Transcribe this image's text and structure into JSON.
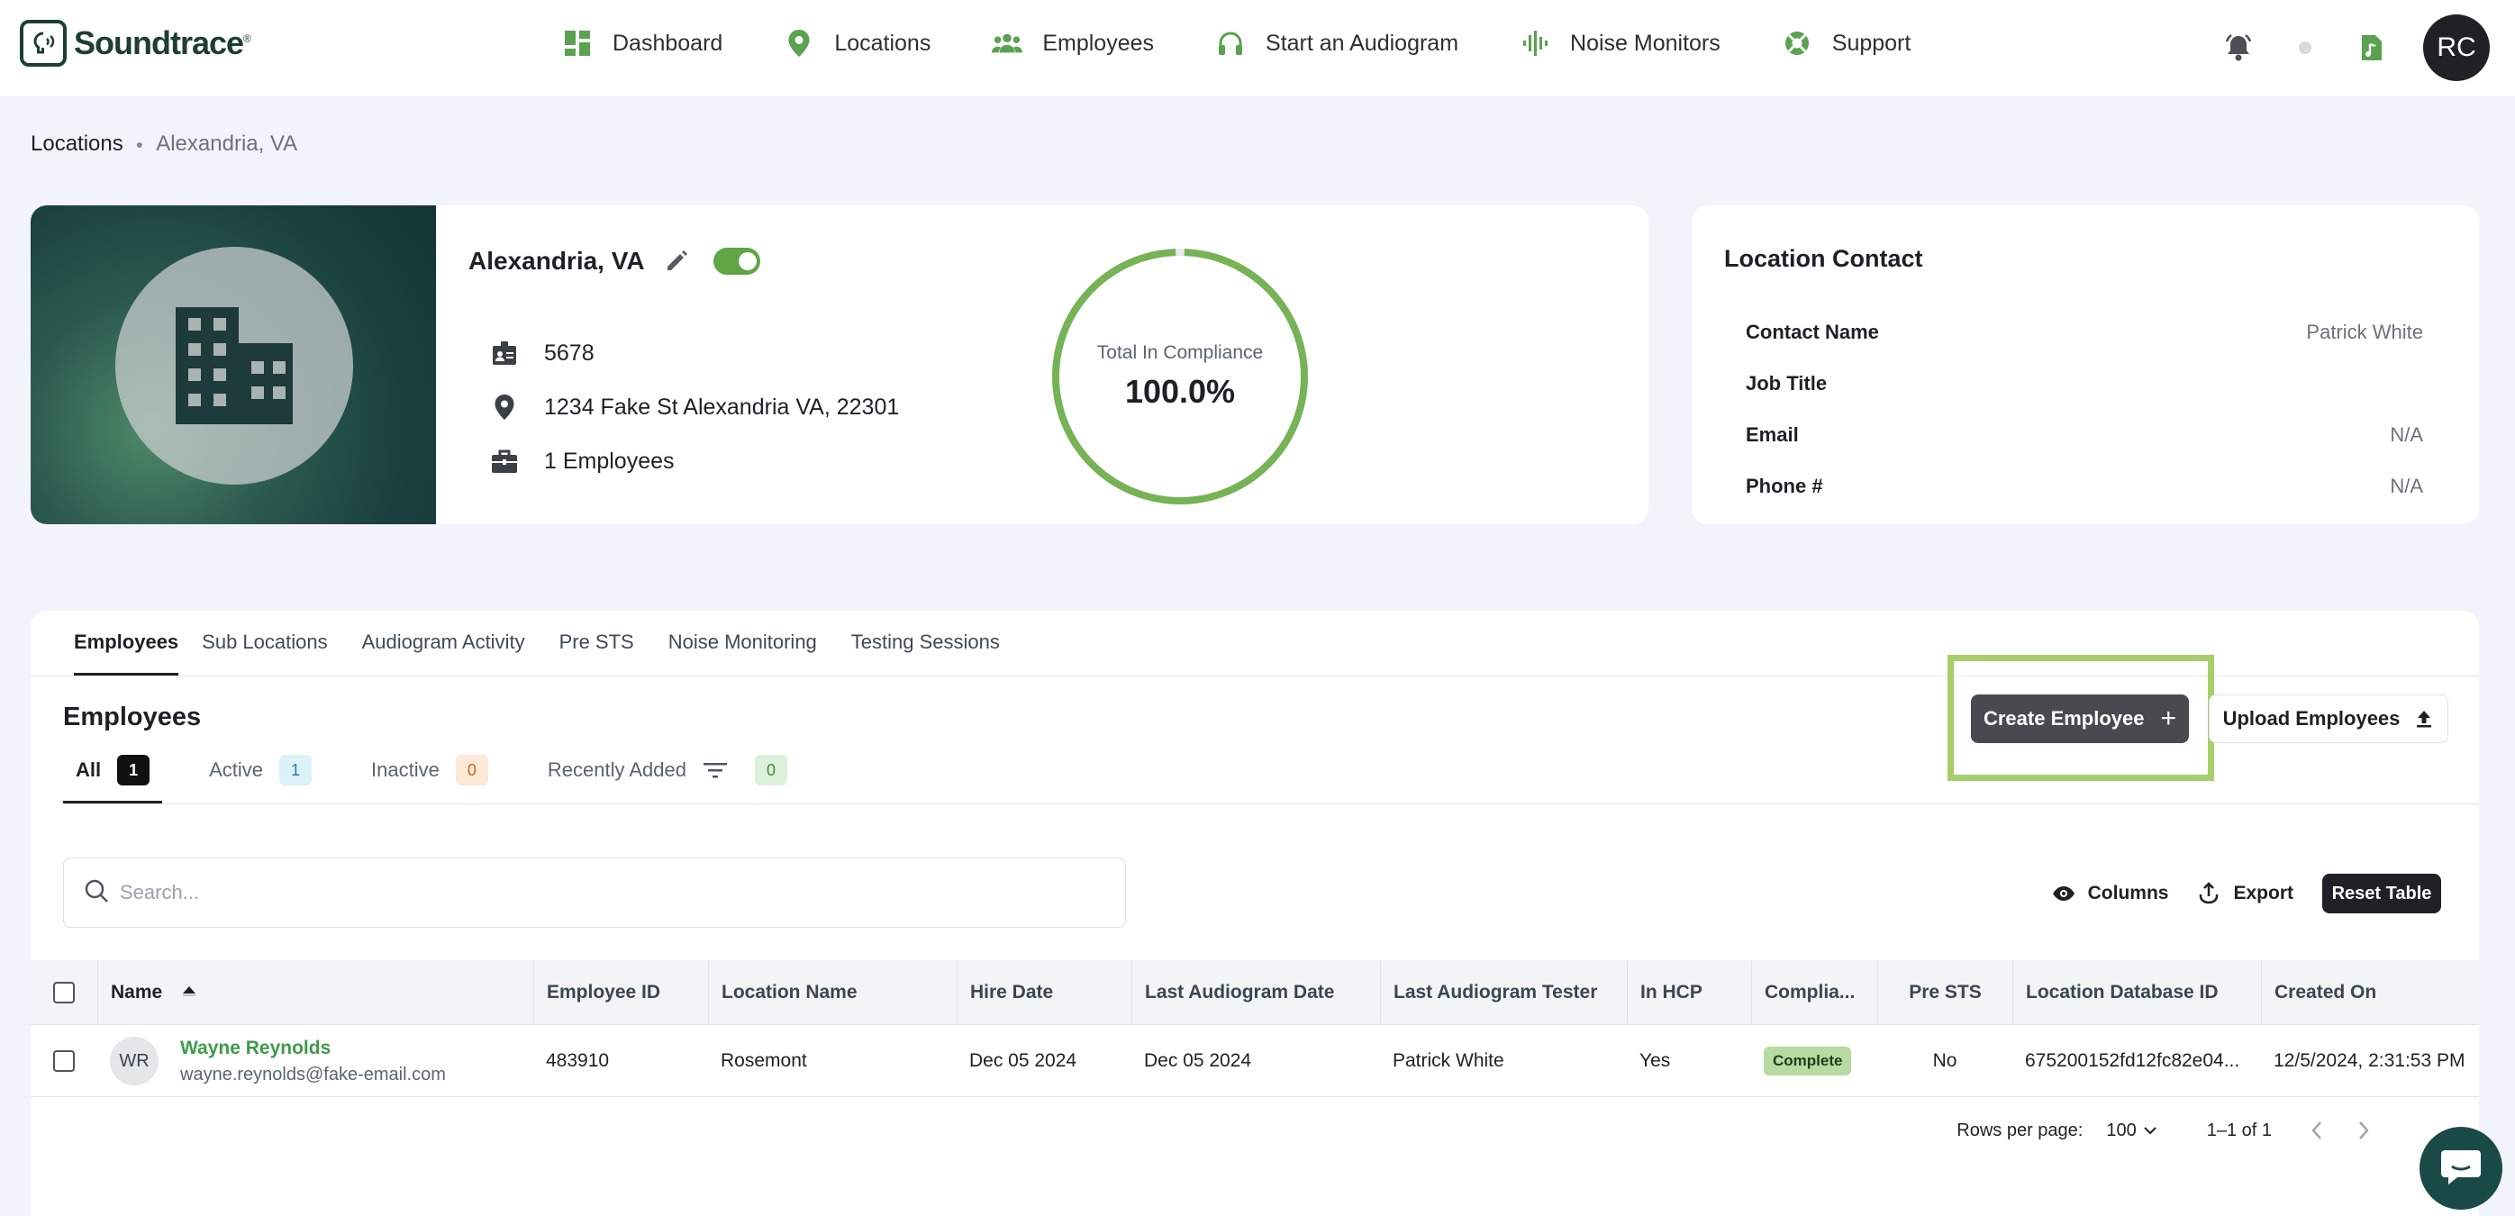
{
  "app": {
    "logo_text": "Soundtrace",
    "user_initials": "RC"
  },
  "nav": {
    "items": [
      {
        "label": "Dashboard",
        "icon": "dashboard-icon"
      },
      {
        "label": "Locations",
        "icon": "map-pin-icon"
      },
      {
        "label": "Employees",
        "icon": "people-icon"
      },
      {
        "label": "Start an Audiogram",
        "icon": "headphones-icon"
      },
      {
        "label": "Noise Monitors",
        "icon": "waveform-icon"
      },
      {
        "label": "Support",
        "icon": "lifebuoy-icon"
      }
    ]
  },
  "breadcrumb": {
    "parent": "Locations",
    "current": "Alexandria, VA"
  },
  "location": {
    "name": "Alexandria, VA",
    "active": true,
    "id": "5678",
    "address": "1234 Fake St Alexandria VA, 22301",
    "employees": "1 Employees",
    "compliance_label": "Total In Compliance",
    "compliance_value": "100.0%",
    "compliance_fraction": 1.0
  },
  "contact": {
    "title": "Location Contact",
    "rows": [
      {
        "key": "Contact Name",
        "value": "Patrick White"
      },
      {
        "key": "Job Title",
        "value": ""
      },
      {
        "key": "Email",
        "value": "N/A"
      },
      {
        "key": "Phone #",
        "value": "N/A"
      }
    ]
  },
  "tabs": [
    "Employees",
    "Sub Locations",
    "Audiogram Activity",
    "Pre STS",
    "Noise Monitoring",
    "Testing Sessions"
  ],
  "employees_panel": {
    "title": "Employees",
    "filters": [
      {
        "label": "All",
        "count": "1"
      },
      {
        "label": "Active",
        "count": "1"
      },
      {
        "label": "Inactive",
        "count": "0"
      },
      {
        "label": "Recently Added",
        "count": "0"
      }
    ],
    "create_label": "Create Employee",
    "upload_label": "Upload Employees",
    "search_placeholder": "Search...",
    "columns_label": "Columns",
    "export_label": "Export",
    "reset_label": "Reset Table"
  },
  "table": {
    "headers": [
      "Name",
      "Employee ID",
      "Location Name",
      "Hire Date",
      "Last Audiogram Date",
      "Last Audiogram Tester",
      "In HCP",
      "Complia...",
      "Pre STS",
      "Location Database ID",
      "Created On"
    ],
    "rows": [
      {
        "initials": "WR",
        "name": "Wayne Reynolds",
        "email": "wayne.reynolds@fake-email.com",
        "employee_id": "483910",
        "location_name": "Rosemont",
        "hire_date": "Dec 05 2024",
        "last_audiogram_date": "Dec 05 2024",
        "last_audiogram_tester": "Patrick White",
        "in_hcp": "Yes",
        "compliance": "Complete",
        "pre_sts": "No",
        "location_db_id": "675200152fd12fc82e04...",
        "created_on": "12/5/2024, 2:31:53 PM"
      }
    ]
  },
  "pager": {
    "rows_per_page_label": "Rows per page:",
    "rows_per_page": "100",
    "range": "1–1 of 1"
  },
  "colors": {
    "brand_dark": "#1f3d35",
    "accent_green": "#5fa544",
    "highlight": "#a6cf6c"
  }
}
